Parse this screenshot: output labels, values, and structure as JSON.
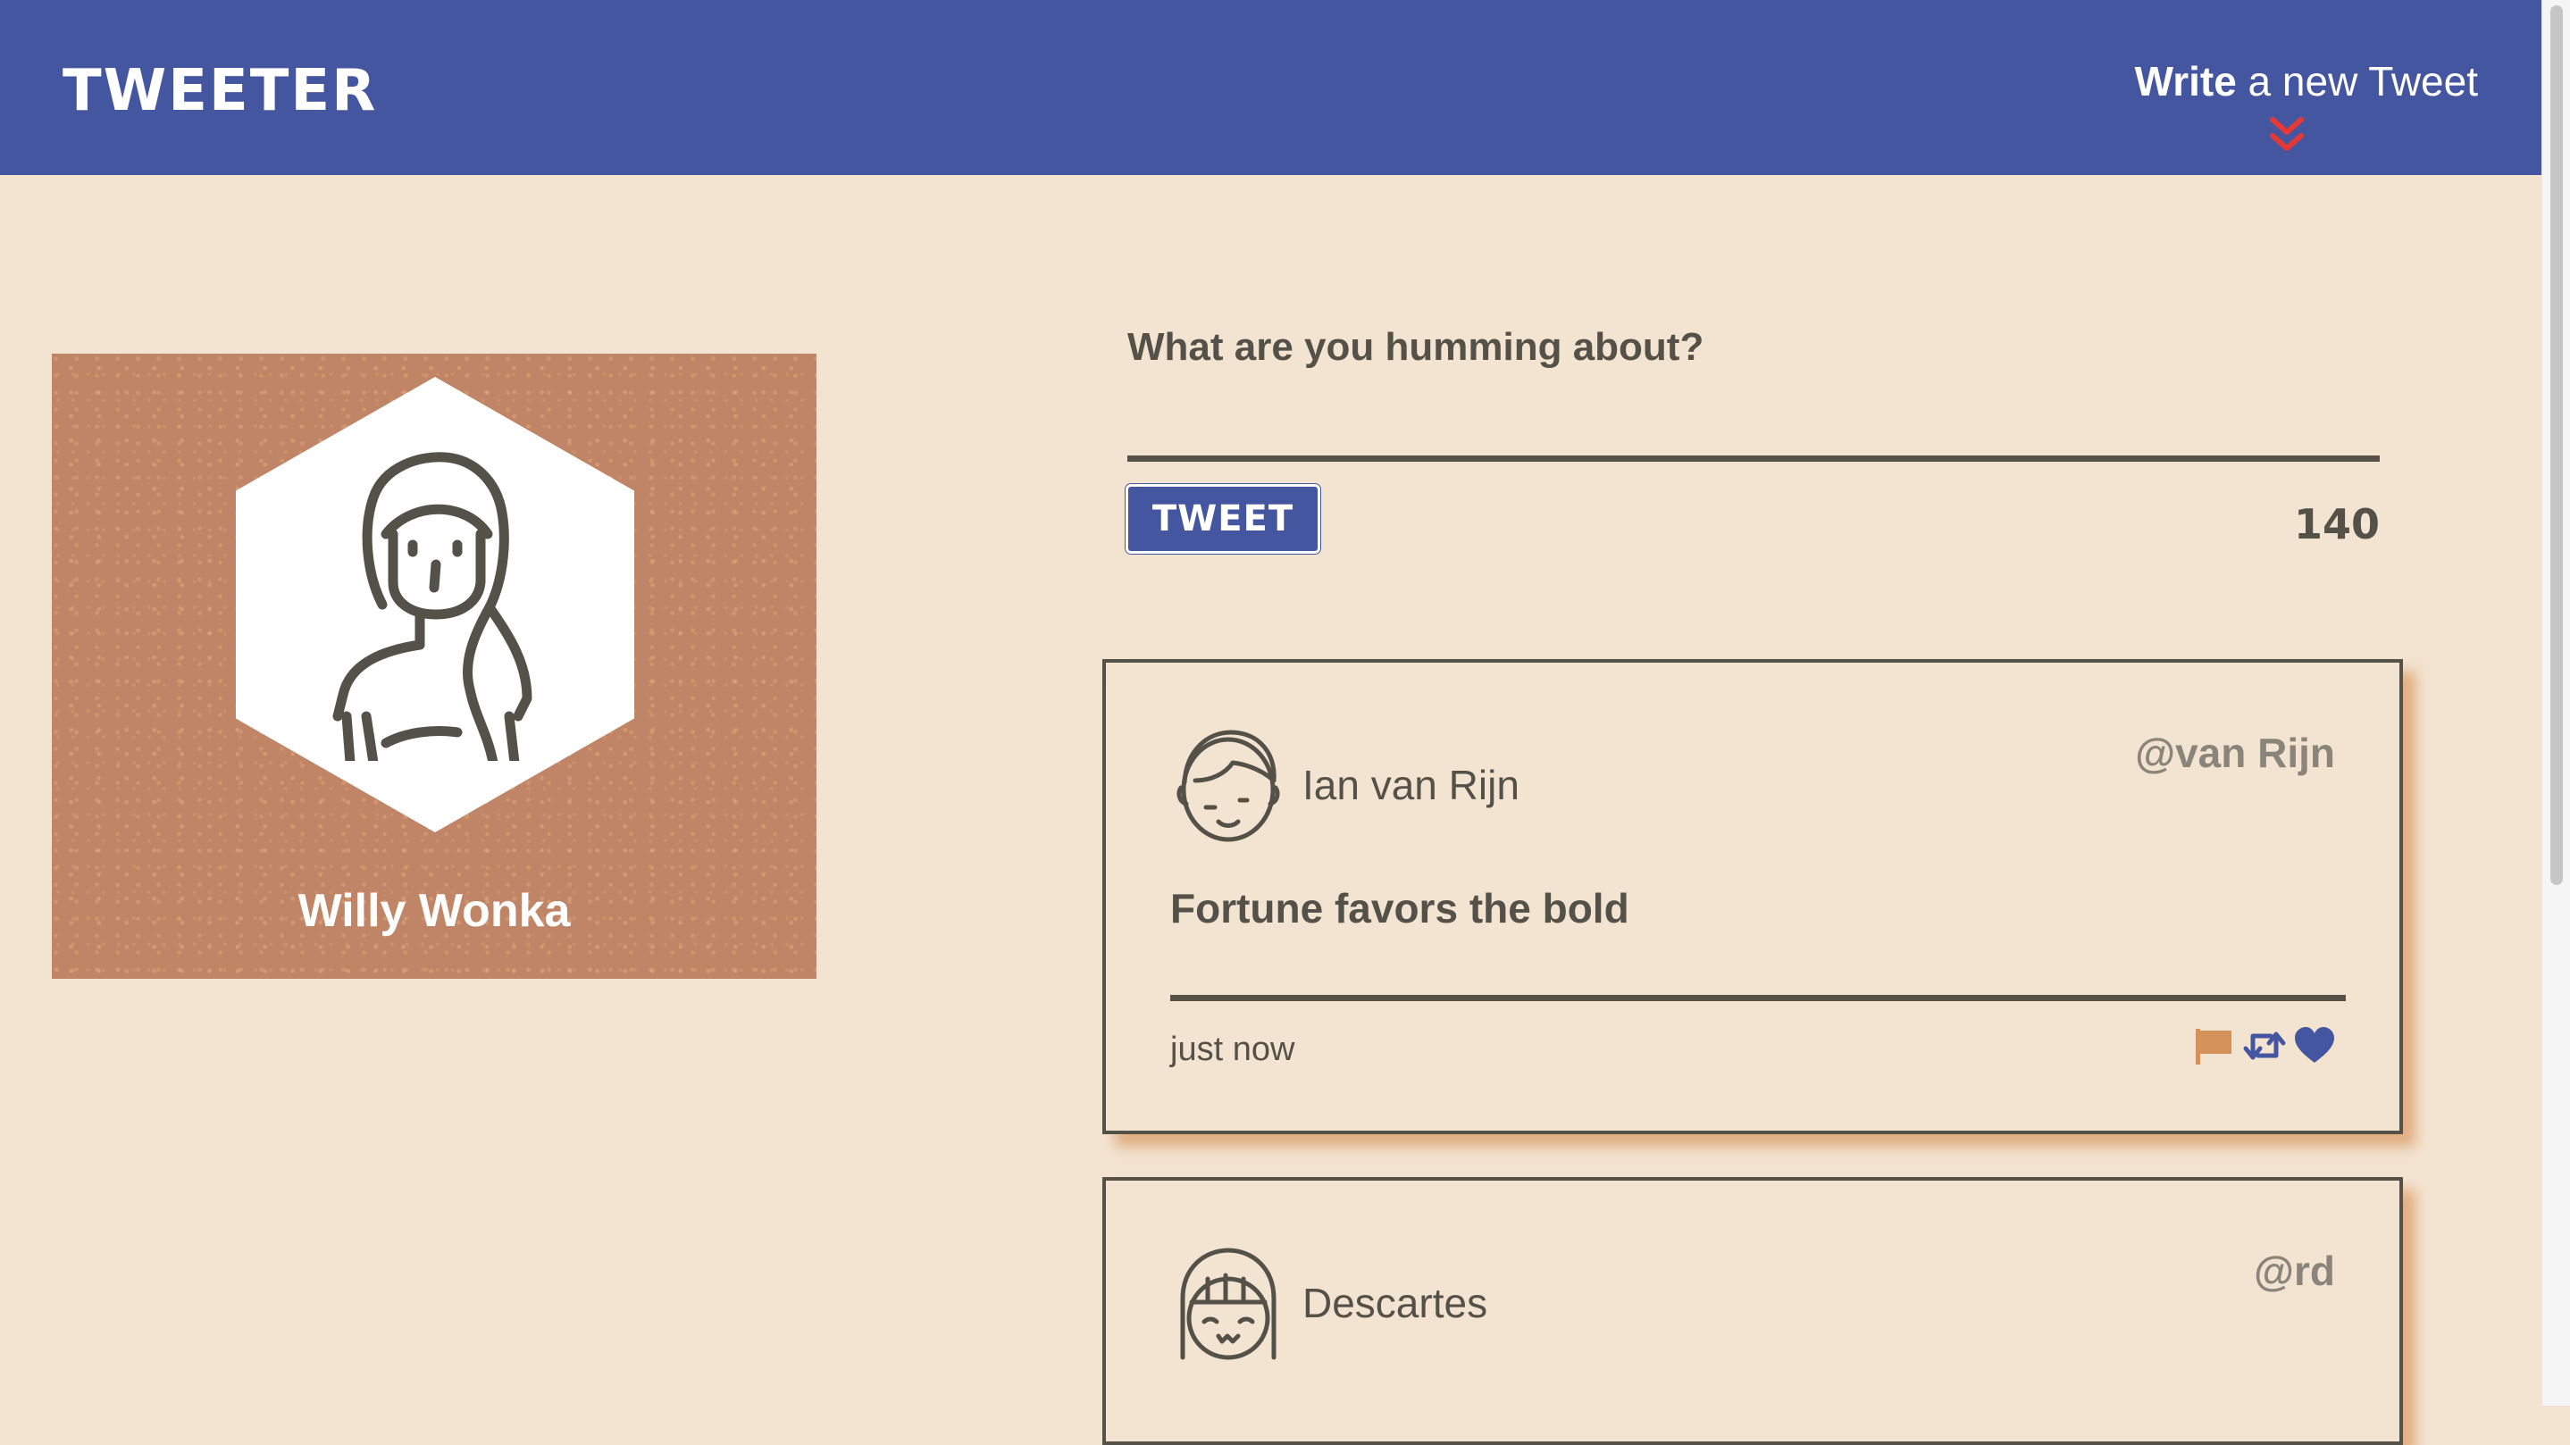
{
  "nav": {
    "logo": "TWEETER",
    "write_bold": "Write",
    "write_rest": " a new Tweet",
    "accent_color": "#ffffff",
    "chevron_color": "#e53935",
    "toggle_icon": "double-chevron-down"
  },
  "profile": {
    "name": "Willy Wonka",
    "background_color": "#c08566",
    "avatar_icon": "girl-avatar"
  },
  "compose": {
    "label": "What are you humming about?",
    "value": "",
    "button_label": "TWEET",
    "counter": "140"
  },
  "tweets": [
    {
      "name": "Ian van Rijn",
      "handle": "@van Rijn",
      "content": "Fortune favors the bold",
      "time": "just now",
      "avatar_icon": "boy-avatar",
      "actions": [
        "flag-icon",
        "retweet-icon",
        "heart-icon"
      ]
    },
    {
      "name": "Descartes",
      "handle": "@rd",
      "avatar_icon": "girl-bangs-avatar"
    }
  ],
  "colors": {
    "nav_bg": "#4556a0",
    "page_bg": "#f3e4d2",
    "text": "#545149",
    "handle": "#8a857b",
    "flag": "#d4915a",
    "retweet": "#4556a0",
    "heart": "#4556a0",
    "tweet_shadow": "#d2823c"
  }
}
